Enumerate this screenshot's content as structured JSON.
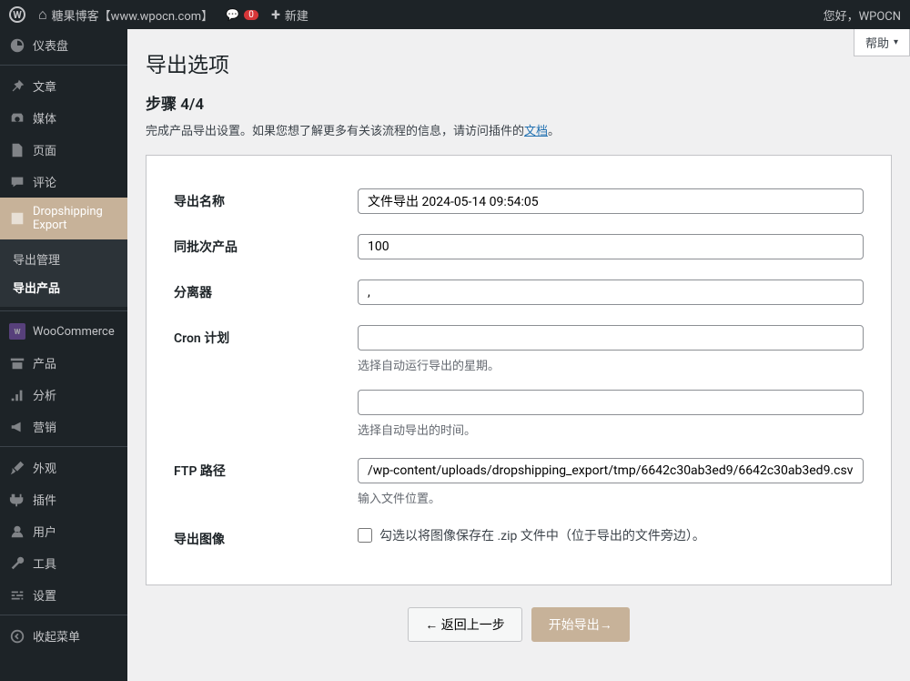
{
  "topbar": {
    "site_name": "糖果博客【www.wpocn.com】",
    "comment_count": "0",
    "new_label": "新建",
    "greeting": "您好，WPOCN"
  },
  "help_label": "帮助",
  "sidebar": {
    "dashboard": "仪表盘",
    "posts": "文章",
    "media": "媒体",
    "pages": "页面",
    "comments": "评论",
    "dropshipping": "Dropshipping Export",
    "submenu_manage": "导出管理",
    "submenu_export": "导出产品",
    "woocommerce": "WooCommerce",
    "products": "产品",
    "analytics": "分析",
    "marketing": "营销",
    "appearance": "外观",
    "plugins": "插件",
    "users": "用户",
    "tools": "工具",
    "settings": "设置",
    "collapse": "收起菜单"
  },
  "page": {
    "title": "导出选项",
    "step": "步骤 4/4",
    "description_prefix": "完成产品导出设置。如果您想了解更多有关该流程的信息，请访问插件的",
    "doc_link": "文档",
    "description_suffix": "。"
  },
  "form": {
    "export_name_label": "导出名称",
    "export_name_value": "文件导出 2024-05-14 09:54:05",
    "batch_label": "同批次产品",
    "batch_value": "100",
    "separator_label": "分离器",
    "separator_value": ",",
    "cron_label": "Cron 计划",
    "cron_day_value": "",
    "cron_day_help": "选择自动运行导出的星期。",
    "cron_time_value": "",
    "cron_time_help": "选择自动导出的时间。",
    "ftp_label": "FTP 路径",
    "ftp_value": "/wp-content/uploads/dropshipping_export/tmp/6642c30ab3ed9/6642c30ab3ed9.csv",
    "ftp_help": "输入文件位置。",
    "export_images_label": "导出图像",
    "export_images_help": "勾选以将图像保存在 .zip 文件中（位于导出的文件旁边）。"
  },
  "actions": {
    "back": "← 返回上一步",
    "start": "开始导出→"
  }
}
